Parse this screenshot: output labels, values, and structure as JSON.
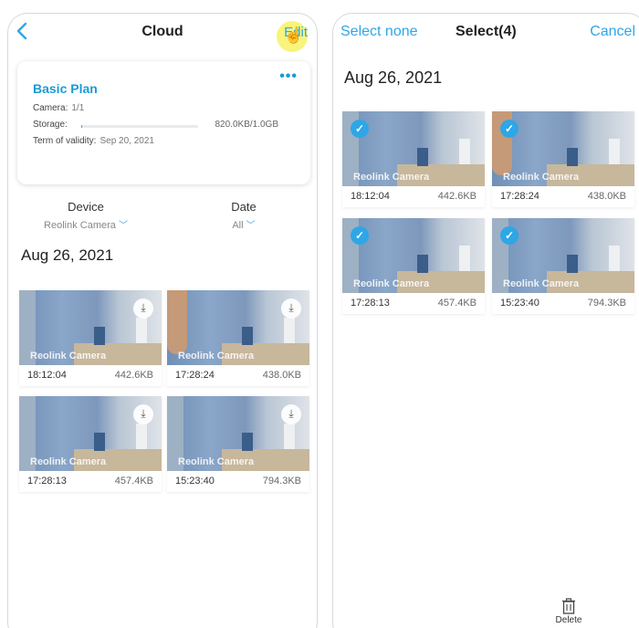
{
  "left": {
    "title": "Cloud",
    "edit_label": "Edit",
    "plan": {
      "name": "Basic Plan",
      "camera_label": "Camera:",
      "camera_value": "1/1",
      "storage_label": "Storage:",
      "storage_value": "820.0KB/1.0GB",
      "storage_used_fraction": 0.0008,
      "validity_label": "Term of validity:",
      "validity_value": "Sep 20, 2021"
    },
    "filters": {
      "device_label": "Device",
      "device_value": "Reolink Camera",
      "date_label": "Date",
      "date_value": "All"
    },
    "date_heading": "Aug 26, 2021",
    "clips": [
      {
        "time": "18:12:04",
        "size": "442.6KB",
        "watermark": "Reolink Camera"
      },
      {
        "time": "17:28:24",
        "size": "438.0KB",
        "watermark": "Reolink Camera"
      },
      {
        "time": "17:28:13",
        "size": "457.4KB",
        "watermark": "Reolink Camera"
      },
      {
        "time": "15:23:40",
        "size": "794.3KB",
        "watermark": "Reolink Camera"
      }
    ]
  },
  "right": {
    "select_none_label": "Select none",
    "title": "Select(4)",
    "cancel_label": "Cancel",
    "date_heading": "Aug 26, 2021",
    "clips": [
      {
        "time": "18:12:04",
        "size": "442.6KB",
        "watermark": "Reolink Camera",
        "selected": true
      },
      {
        "time": "17:28:24",
        "size": "438.0KB",
        "watermark": "Reolink Camera",
        "selected": true
      },
      {
        "time": "17:28:13",
        "size": "457.4KB",
        "watermark": "Reolink Camera",
        "selected": true
      },
      {
        "time": "15:23:40",
        "size": "794.3KB",
        "watermark": "Reolink Camera",
        "selected": true
      }
    ],
    "delete_label": "Delete"
  },
  "colors": {
    "accent": "#2fa6e6",
    "plan_title": "#1b9ad6"
  },
  "icons": {
    "back": "chevron-left-icon",
    "more": "more-horizontal-icon",
    "download": "download-icon",
    "check": "check-circle-icon",
    "delete": "trash-icon",
    "pointer": "hand-pointer-icon"
  }
}
